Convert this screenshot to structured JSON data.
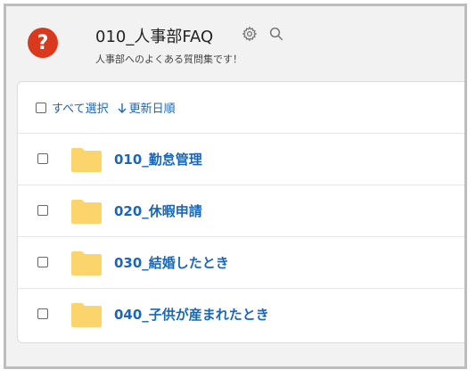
{
  "header": {
    "help_badge": "?",
    "title": "010_人事部FAQ",
    "subtitle": "人事部へのよくある質問集です！",
    "icons": [
      "gear-icon",
      "search-icon"
    ]
  },
  "toolbar": {
    "select_all_label": "すべて選択",
    "sort_label": "更新日順",
    "sort_icon": "arrow-down-icon"
  },
  "folders": [
    {
      "label": "010_勤怠管理"
    },
    {
      "label": "020_休暇申請"
    },
    {
      "label": "030_結婚したとき"
    },
    {
      "label": "040_子供が産まれたとき"
    }
  ],
  "colors": {
    "accent": "#1a66b8",
    "badge": "#d93a1e",
    "folder": "#fbd56b"
  }
}
